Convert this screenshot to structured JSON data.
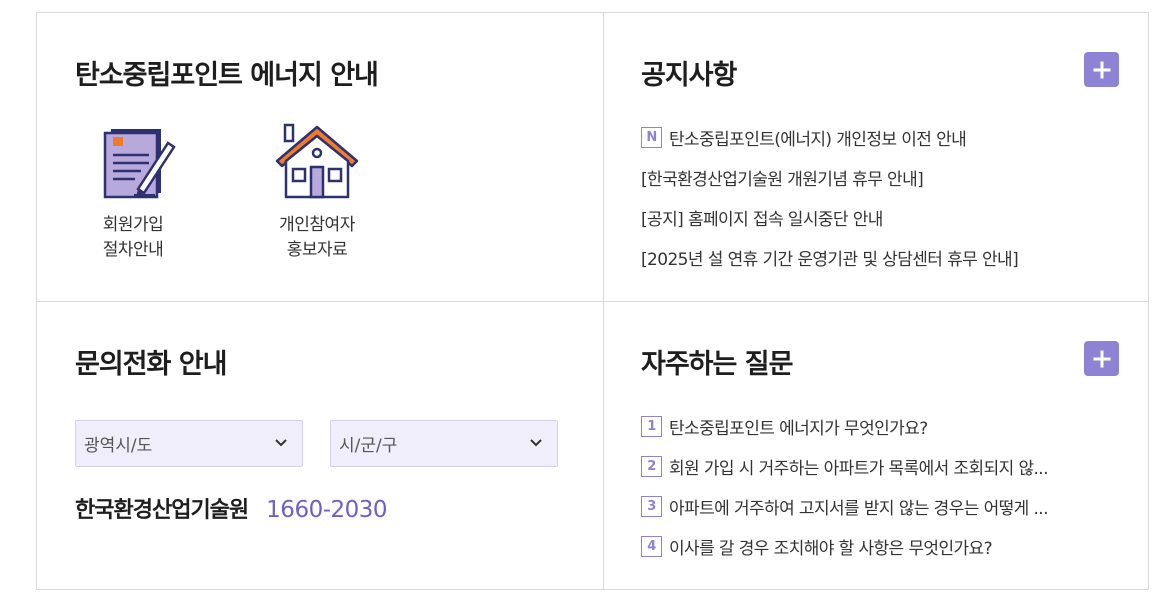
{
  "energy": {
    "title": "탄소중립포인트 에너지 안내",
    "links": [
      {
        "label_1": "회원가입",
        "label_2": "절차안내",
        "icon": "document-pen-icon"
      },
      {
        "label_1": "개인참여자",
        "label_2": "홍보자료",
        "icon": "house-icon"
      }
    ]
  },
  "notices": {
    "title": "공지사항",
    "badge": "N",
    "items": [
      "탄소중립포인트(에너지) 개인정보 이전 안내",
      "[한국환경산업기술원 개원기념 휴무 안내]",
      "[공지] 홈페이지 접속 일시중단 안내",
      "[2025년 설 연휴 기간 운영기관 및 상담센터 휴무 안내]"
    ]
  },
  "contact": {
    "title": "문의전화 안내",
    "select_region": "광역시/도",
    "select_city": "시/군/구",
    "org": "한국환경산업기술원",
    "phone": "1660-2030"
  },
  "faq": {
    "title": "자주하는 질문",
    "items": [
      {
        "num": "1",
        "text": "탄소중립포인트 에너지가 무엇인가요?"
      },
      {
        "num": "2",
        "text": "회원 가입 시 거주하는 아파트가 목록에서 조회되지 않..."
      },
      {
        "num": "3",
        "text": "아파트에 거주하여 고지서를 받지 않는 경우는 어떻게 ..."
      },
      {
        "num": "4",
        "text": "이사를 갈 경우 조치해야 할 사항은 무엇인가요?"
      }
    ]
  },
  "colors": {
    "accent": "#8e82d4",
    "phone": "#6d5fc7",
    "select_bg": "#f0eefa",
    "icon_orange": "#f07b2b",
    "icon_navy": "#2e3170"
  }
}
